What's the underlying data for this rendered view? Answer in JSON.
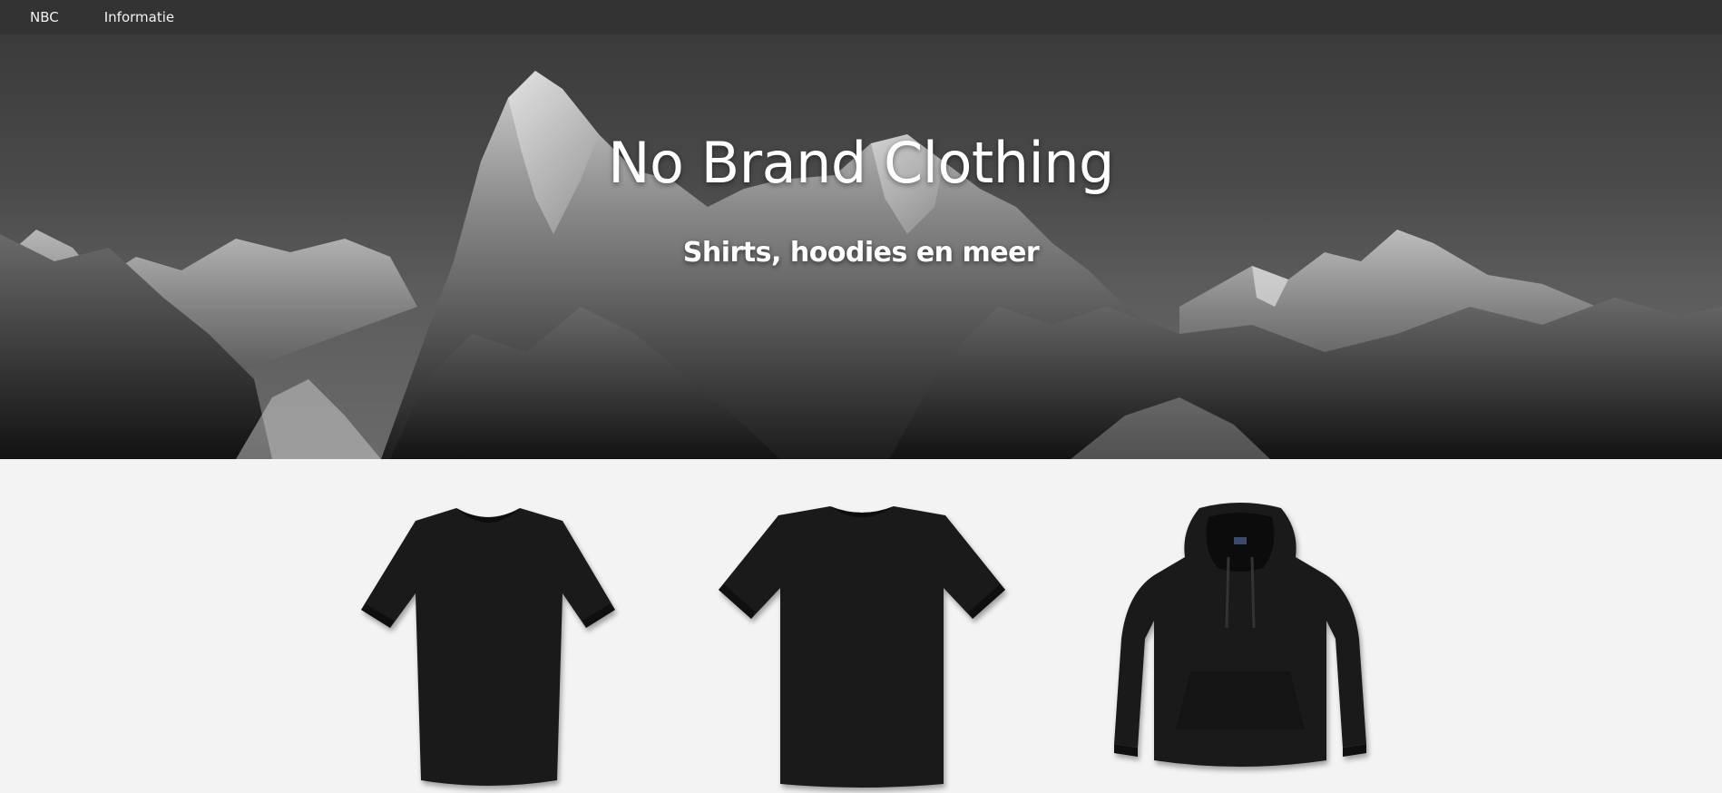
{
  "navbar": {
    "brand_label": "NBC",
    "info_label": "Informatie",
    "background_color": "#333333"
  },
  "hero": {
    "title": "No Brand Clothing",
    "subtitle": "Shirts, hoodies en meer",
    "background_image": "grayscale mountain range"
  },
  "products": [
    {
      "kind": "t-shirt-fitted",
      "icon": "tshirt-icon",
      "color": "#1a1a1a"
    },
    {
      "kind": "t-shirt-regular",
      "icon": "tshirt-icon",
      "color": "#1a1a1a"
    },
    {
      "kind": "hoodie",
      "icon": "hoodie-icon",
      "color": "#1a1a1a"
    }
  ]
}
